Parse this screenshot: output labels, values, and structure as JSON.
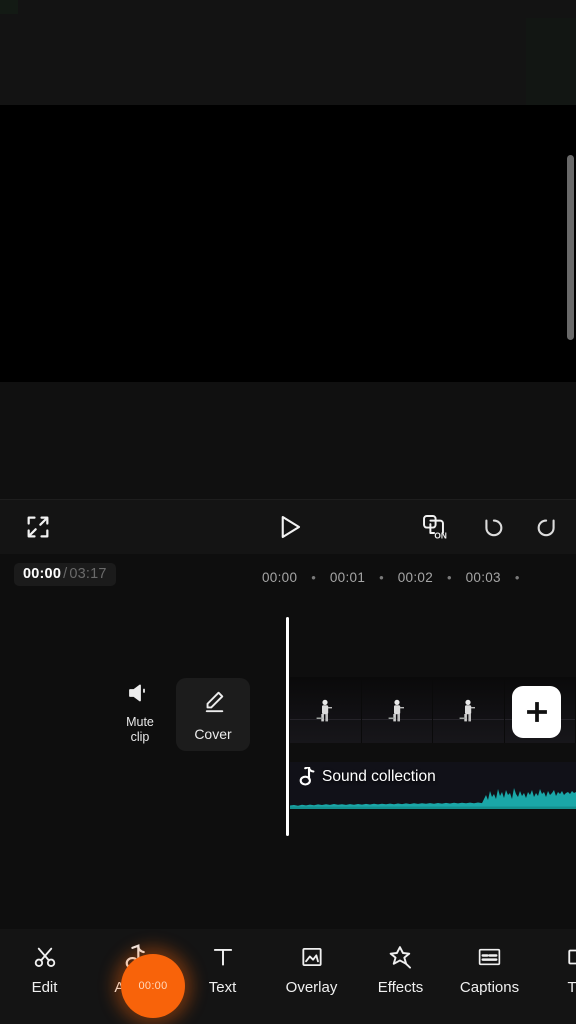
{
  "app": {
    "name": "video-editor",
    "accent_color": "#f8630a",
    "background_color": "#0e0e0e",
    "waveform_color": "#1aa7a8"
  },
  "preview": {
    "name": "video-preview",
    "background_color": "#000000",
    "scrollbar_color": "#7b7b7b"
  },
  "player_bar": {
    "fullscreen_icon": "fullscreen-expand-icon",
    "play_icon": "play-icon",
    "keyframe_icon": "keyframe-on-icon",
    "keyframe_label": "ON",
    "undo_icon": "undo-icon",
    "redo_icon": "redo-icon"
  },
  "ruler": {
    "current_time": "00:00",
    "separator": "/",
    "total_time": "03:17",
    "ticks": [
      "00:00",
      "00:01",
      "00:02",
      "00:03"
    ],
    "tick_dot": "•"
  },
  "timeline": {
    "mute_clip": {
      "icon": "speaker-mute-icon",
      "label_line1": "Mute",
      "label_line2": "clip"
    },
    "cover": {
      "icon": "pencil-edit-icon",
      "label": "Cover"
    },
    "playhead_name": "playhead",
    "add_clip_icon": "plus-icon",
    "video_track_name": "video-clip-track",
    "audio_track": {
      "icon": "music-note-icon",
      "label": "Sound collection"
    }
  },
  "bottom_toolbar": {
    "items": [
      {
        "label": "Edit",
        "icon": "scissors-icon"
      },
      {
        "label": "Audio",
        "icon": "music-note-icon"
      },
      {
        "label": "Text",
        "icon": "text-t-icon"
      },
      {
        "label": "Overlay",
        "icon": "image-frame-icon"
      },
      {
        "label": "Effects",
        "icon": "sparkle-star-icon"
      },
      {
        "label": "Captions",
        "icon": "captions-icon"
      },
      {
        "label": "Tra",
        "icon": "transitions-icon"
      }
    ]
  },
  "touch_indicator": {
    "name": "touch-tap-indicator",
    "label": "00:00",
    "color": "#f8630a"
  }
}
